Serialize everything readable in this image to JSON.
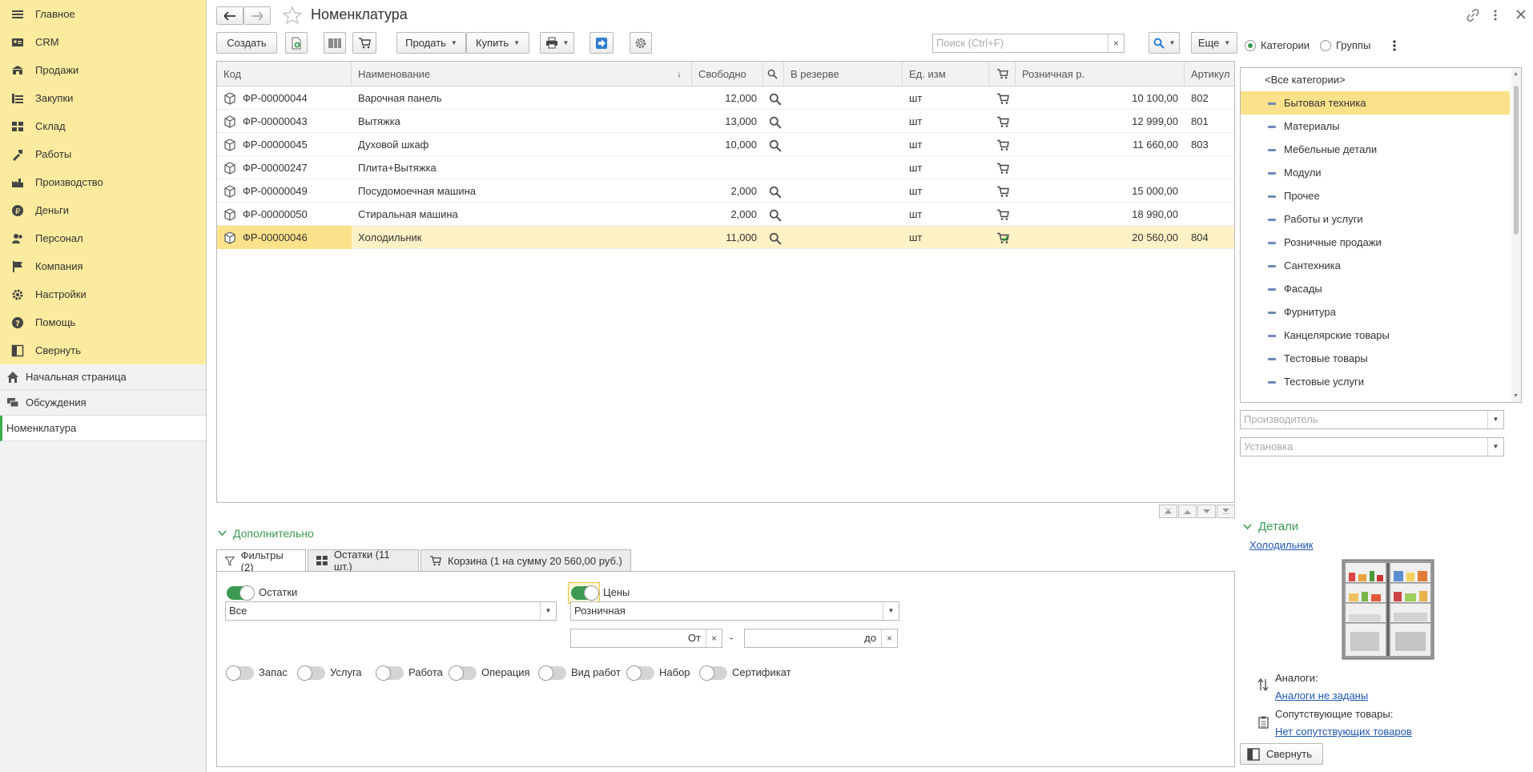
{
  "sidebar": {
    "sections": [
      {
        "label": "Главное",
        "icon": "menu-icon"
      },
      {
        "label": "CRM",
        "icon": "crm-icon"
      },
      {
        "label": "Продажи",
        "icon": "sales-icon"
      },
      {
        "label": "Закупки",
        "icon": "purchases-icon"
      },
      {
        "label": "Склад",
        "icon": "warehouse-icon"
      },
      {
        "label": "Работы",
        "icon": "tools-icon"
      },
      {
        "label": "Производство",
        "icon": "factory-icon"
      },
      {
        "label": "Деньги",
        "icon": "money-icon"
      },
      {
        "label": "Персонал",
        "icon": "people-icon"
      },
      {
        "label": "Компания",
        "icon": "flag-icon"
      },
      {
        "label": "Настройки",
        "icon": "gear-icon"
      },
      {
        "label": "Помощь",
        "icon": "help-icon"
      },
      {
        "label": "Свернуть",
        "icon": "collapse-icon"
      }
    ],
    "open_windows": [
      {
        "label": "Начальная страница",
        "icon": "home-icon"
      },
      {
        "label": "Обсуждения",
        "icon": "chat-icon"
      },
      {
        "label": "Номенклатура",
        "icon": ""
      }
    ]
  },
  "header": {
    "title": "Номенклатура"
  },
  "toolbar": {
    "create_label": "Создать",
    "sell_label": "Продать",
    "buy_label": "Купить",
    "search_placeholder": "Поиск (Ctrl+F)",
    "more_label": "Еще"
  },
  "table": {
    "columns": [
      "Код",
      "Наименование",
      "Свободно",
      "В резерве",
      "Ед. изм",
      "Розничная р.",
      "Артикул"
    ],
    "rows": [
      {
        "code": "ФР-00000044",
        "name": "Варочная панель",
        "free": "12,000",
        "unit": "шт",
        "price": "10 100,00",
        "article": "802",
        "has_search": true
      },
      {
        "code": "ФР-00000043",
        "name": "Вытяжка",
        "free": "13,000",
        "unit": "шт",
        "price": "12 999,00",
        "article": "801",
        "has_search": true
      },
      {
        "code": "ФР-00000045",
        "name": "Духовой шкаф",
        "free": "10,000",
        "unit": "шт",
        "price": "11 660,00",
        "article": "803",
        "has_search": true
      },
      {
        "code": "ФР-00000247",
        "name": "Плита+Вытяжка",
        "free": "",
        "unit": "шт",
        "price": "",
        "article": "",
        "has_search": false
      },
      {
        "code": "ФР-00000049",
        "name": "Посудомоечная машина",
        "free": "2,000",
        "unit": "шт",
        "price": "15 000,00",
        "article": "",
        "has_search": true
      },
      {
        "code": "ФР-00000050",
        "name": "Стиральная машина",
        "free": "2,000",
        "unit": "шт",
        "price": "18 990,00",
        "article": "",
        "has_search": true
      },
      {
        "code": "ФР-00000046",
        "name": "Холодильник",
        "free": "11,000",
        "unit": "шт",
        "price": "20 560,00",
        "article": "804",
        "has_search": true
      }
    ]
  },
  "bottom": {
    "section_label": "Дополнительно",
    "tabs": [
      "Фильтры (2)",
      "Остатки (11 шт.)",
      "Корзина (1 на сумму 20 560,00 руб.)"
    ],
    "stock_toggle_label": "Остатки",
    "prices_toggle_label": "Цены",
    "stock_select": "Все",
    "price_type_select": "Розничная",
    "from_label": "От",
    "to_label": "до",
    "range_sep": "-",
    "type_toggles": [
      "Запас",
      "Услуга",
      "Работа",
      "Операция",
      "Вид работ",
      "Набор",
      "Сертификат"
    ]
  },
  "right": {
    "radio_categories": "Категории",
    "radio_groups": "Группы",
    "categories": [
      "<Все категории>",
      "Бытовая техника",
      "Материалы",
      "Мебельные детали",
      "Модули",
      "Прочее",
      "Работы и услуги",
      "Розничные продажи",
      "Сантехника",
      "Фасады",
      "Фурнитура",
      "Канцелярские товары",
      "Тестовые товары",
      "Тестовые услуги"
    ],
    "manufacturer_placeholder": "Производитель",
    "installation_placeholder": "Установка",
    "details_label": "Детали",
    "details_item": "Холодильник",
    "analogs_label": "Аналоги:",
    "analogs_link": "Аналоги не заданы",
    "related_label": "Сопутствующие товары:",
    "related_link": "Нет сопутствующих товаров",
    "collapse_label": "Свернуть"
  },
  "colors": {
    "sidebar_bg": "#fbeb9e",
    "accent_green": "#3c9a52",
    "selection": "#fdf1c6",
    "link": "#1f56b3"
  }
}
